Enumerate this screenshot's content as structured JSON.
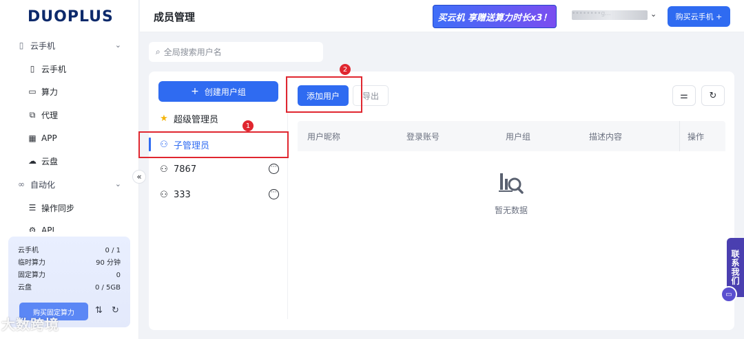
{
  "brand": {
    "logo": "DUOPLUS"
  },
  "sidebar": {
    "groups": [
      {
        "label": "云手机",
        "icon": "phone-outline-icon"
      },
      {
        "label": "自动化",
        "icon": "infinity-icon"
      }
    ],
    "items": [
      {
        "label": "云手机",
        "icon": "phone-icon"
      },
      {
        "label": "算力",
        "icon": "monitor-icon"
      },
      {
        "label": "代理",
        "icon": "network-icon"
      },
      {
        "label": "APP",
        "icon": "grid-icon"
      },
      {
        "label": "云盘",
        "icon": "cloud-icon"
      },
      {
        "label": "操作同步",
        "icon": "sync-icon"
      },
      {
        "label": "API",
        "icon": "api-icon"
      }
    ]
  },
  "usage": {
    "rows": [
      {
        "label": "云手机",
        "value": "0 / 1"
      },
      {
        "label": "临时算力",
        "value": "90 分钟"
      },
      {
        "label": "固定算力",
        "value": "0"
      },
      {
        "label": "云盘",
        "value": "0 / 5GB"
      }
    ],
    "buy_fixed_label": "购买固定算力"
  },
  "watermark": "大数跨境",
  "header": {
    "title": "成员管理",
    "promo": "买云机 享赠送算力时长x3！",
    "account_name": "••••••••g...",
    "buy_phone_label": "购买云手机 +"
  },
  "search": {
    "placeholder": "全局搜索用户名",
    "value": ""
  },
  "groups_panel": {
    "create_label": "创建用户组",
    "items": [
      {
        "label": "超级管理员",
        "icon": "star-icon",
        "active": false,
        "has_more": false
      },
      {
        "label": "子管理员",
        "icon": "user-icon",
        "active": true,
        "has_more": false
      },
      {
        "label": "7867",
        "icon": "user-icon",
        "active": false,
        "has_more": true
      },
      {
        "label": "333",
        "icon": "user-icon",
        "active": false,
        "has_more": true
      }
    ]
  },
  "toolbar": {
    "add_user_label": "添加用户",
    "export_label": "导出"
  },
  "table": {
    "columns": [
      "用户昵称",
      "登录账号",
      "用户组",
      "描述内容",
      "操作"
    ],
    "empty_text": "暂无数据"
  },
  "annotations": [
    {
      "number": "1"
    },
    {
      "number": "2"
    }
  ],
  "contact": {
    "label": "联系我们"
  },
  "colors": {
    "primary": "#2f6bf1",
    "highlight": "#e0262f",
    "contact": "#4a3fb0"
  }
}
